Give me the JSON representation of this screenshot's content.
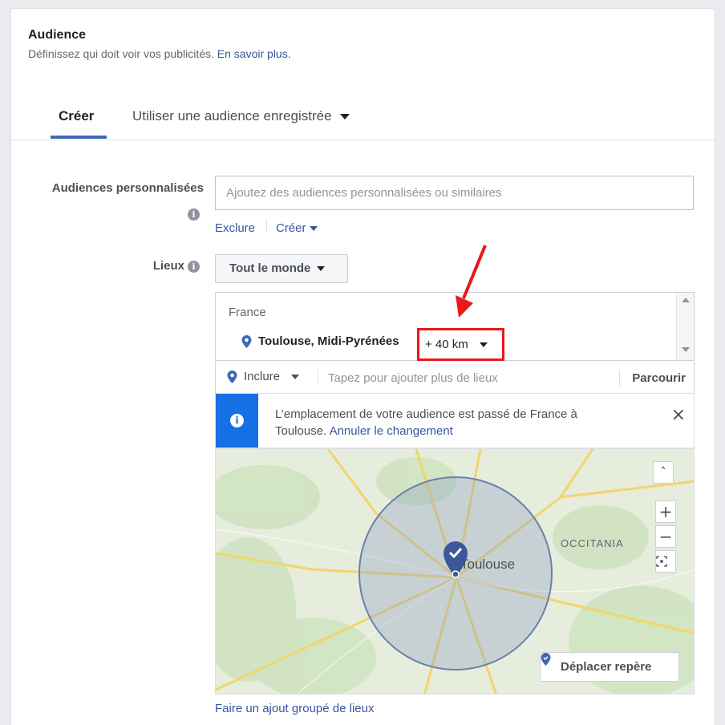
{
  "header": {
    "title": "Audience",
    "subtitle": "Définissez qui doit voir vos publicités.",
    "learn_more": "En savoir plus."
  },
  "tabs": [
    {
      "label": "Créer",
      "active": true
    },
    {
      "label": "Utiliser une audience enregistrée",
      "active": false
    }
  ],
  "custom_audiences": {
    "label": "Audiences personnalisées",
    "placeholder": "Ajoutez des audiences personnalisées ou similaires",
    "exclude_link": "Exclure",
    "create_link": "Créer"
  },
  "locations": {
    "label": "Lieux",
    "scope_button": "Tout le monde",
    "country": "France",
    "city": "Toulouse, Midi-Pyrénées",
    "radius": "+ 40 km",
    "include_label": "Inclure",
    "search_placeholder": "Tapez pour ajouter plus de lieux",
    "browse_label": "Parcourir"
  },
  "notice": {
    "text": "L’emplacement de votre audience est passé de France à Toulouse.",
    "undo_link": "Annuler le changement",
    "close": "×"
  },
  "map": {
    "city_label": "Toulouse",
    "region_label": "OCCITANIA",
    "zoom_in": "+",
    "zoom_out": "−",
    "collapse": "˄",
    "move_pin_label": "Déplacer repère"
  },
  "footer": {
    "bulk_link": "Faire un ajout groupé de lieux"
  },
  "colors": {
    "link": "#365899",
    "accent": "#4267b2",
    "highlight": "#e8191a",
    "notice_bar": "#166fe5"
  }
}
